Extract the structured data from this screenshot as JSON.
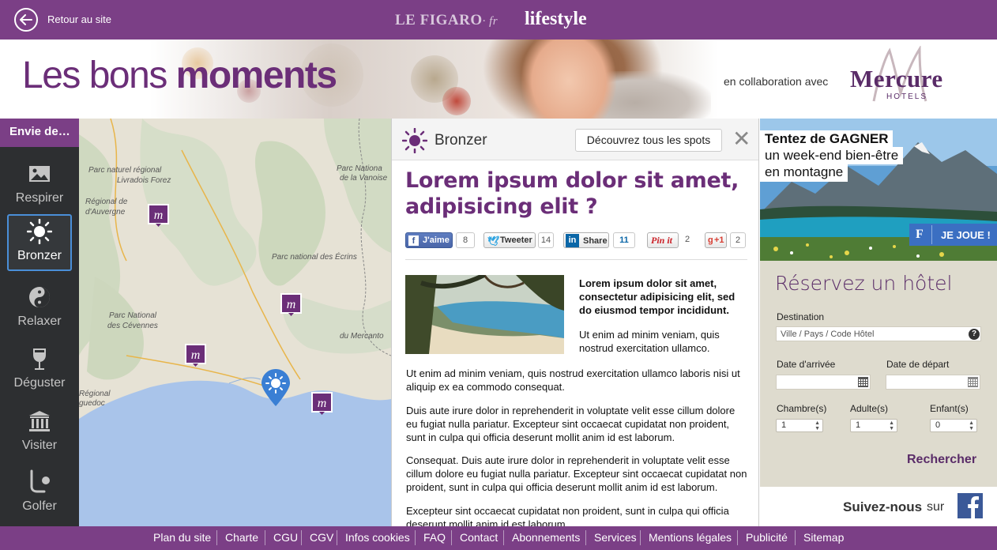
{
  "header": {
    "back_label": "Retour au site",
    "brand_figaro": "LE FIGARO",
    "brand_fr": "· fr",
    "brand_lifestyle": "lifestyle"
  },
  "banner": {
    "tagline_light": "Les bons ",
    "tagline_bold": "moments",
    "collab": "en collaboration avec",
    "partner_name": "Mercure",
    "partner_sub": "HOTELS"
  },
  "sidebar": {
    "header": "Envie de…",
    "items": [
      {
        "label": "Respirer",
        "icon": "image-icon"
      },
      {
        "label": "Bronzer",
        "icon": "sun-icon",
        "active": true
      },
      {
        "label": "Relaxer",
        "icon": "yin-yang-icon"
      },
      {
        "label": "Déguster",
        "icon": "wine-glass-icon"
      },
      {
        "label": "Visiter",
        "icon": "monument-icon"
      },
      {
        "label": "Golfer",
        "icon": "golf-icon"
      }
    ]
  },
  "map": {
    "labels": [
      "Parc naturel régional",
      "Livradois Forez",
      "Parc Nationa",
      "de la Vanoise",
      "Régional de",
      "d'Auvergne",
      "Parc national des Écrins",
      "Parc National",
      "des Cévennes",
      "du Mercanto",
      "Régional",
      "guedoc"
    ]
  },
  "article": {
    "category": "Bronzer",
    "spots_button": "Découvrez tous les spots",
    "close": "✕",
    "title": "Lorem ipsum dolor sit amet, adipisicing elit ?",
    "share": {
      "facebook_label": "J'aime",
      "facebook_count": "8",
      "twitter_label": "Tweeter",
      "twitter_count": "14",
      "linkedin_label": "Share",
      "linkedin_count": "11",
      "pinterest_label": "Pin it",
      "pinterest_count": "2",
      "gplus_label": "+1",
      "gplus_count": "2"
    },
    "lead": "Lorem ipsum dolor sit amet, consectetur adipisicing elit, sed do eiusmod tempor incididunt.",
    "intro": "Ut enim ad minim veniam, quis nostrud exercitation ullamco.",
    "paragraphs": [
      "Ut enim ad minim veniam, quis nostrud exercitation ullamco laboris nisi ut aliquip ex ea commodo consequat.",
      "Duis aute irure dolor in reprehenderit in voluptate velit esse cillum dolore eu fugiat nulla pariatur. Excepteur sint occaecat cupidatat non proident, sunt in culpa qui officia deserunt mollit anim id est laborum.",
      "Consequat. Duis aute irure dolor in reprehenderit in voluptate velit esse cillum dolore eu fugiat nulla pariatur. Excepteur sint occaecat cupidatat non proident, sunt in culpa qui officia deserunt mollit anim id est laborum.",
      "Excepteur sint occaecat cupidatat non proident, sunt in culpa qui officia deserunt mollit anim id est laborum."
    ]
  },
  "promo": {
    "title": "Tentez de GAGNER",
    "line1": "un week-end bien-être",
    "line2": "en montagne",
    "cta": "JE JOUE !"
  },
  "booking": {
    "title": "Réservez un hôtel",
    "destination_label": "Destination",
    "destination_placeholder": "Ville / Pays / Code Hôtel",
    "help": "?",
    "arrival_label": "Date d'arrivée",
    "departure_label": "Date de départ",
    "rooms_label": "Chambre(s)",
    "adults_label": "Adulte(s)",
    "children_label": "Enfant(s)",
    "rooms_value": "1",
    "adults_value": "1",
    "children_value": "0",
    "search_button": "Rechercher"
  },
  "follow": {
    "label": "Suivez-nous",
    "sur": "sur"
  },
  "footer": {
    "links": [
      "Plan du site",
      "Charte",
      "CGU",
      "CGV",
      "Infos cookies",
      "FAQ",
      "Contact",
      "Abonnements",
      "Services",
      "Mentions légales",
      "Publicité",
      "Sitemap"
    ]
  },
  "colors": {
    "brand_purple": "#7b3f86",
    "accent_purple": "#6b2e78",
    "sidebar_dark": "#2d2f31",
    "active_border": "#4a8fd8",
    "booking_bg": "#dedbce",
    "facebook_blue": "#3b5998"
  }
}
